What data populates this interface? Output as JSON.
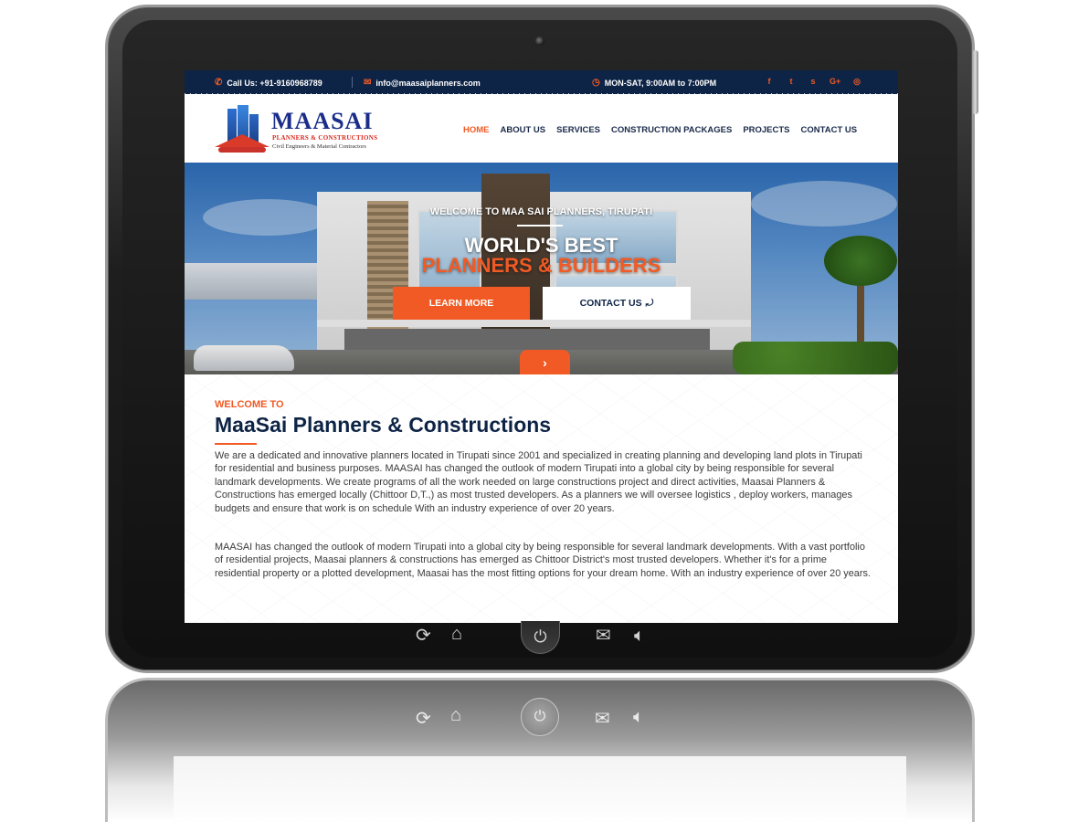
{
  "topbar": {
    "phone": "Call Us: +91-9160968789",
    "email": "info@maasaiplanners.com",
    "hours": "MON-SAT, 9:00AM to 7:00PM",
    "social": [
      "facebook-icon",
      "twitter-icon",
      "skype-icon",
      "google-plus-icon",
      "instagram-icon"
    ],
    "social_glyphs": [
      "f",
      "t",
      "s",
      "G+",
      "◎"
    ]
  },
  "logo": {
    "title": "MAASAI",
    "subtitle": "PLANNERS & CONSTRUCTIONS",
    "tagline": "Civil Engineers & Material Contractors"
  },
  "nav": {
    "items": [
      "HOME",
      "ABOUT US",
      "SERVICES",
      "CONSTRUCTION PACKAGES",
      "PROJECTS",
      "CONTACT US"
    ],
    "active": "HOME"
  },
  "hero": {
    "welcome": "WELCOME TO MAA SAI PLANNERS, TIRUPATI",
    "title_line1": "WORLD'S BEST",
    "title_line2": "PLANNERS & BUILDERS",
    "learn_more": "LEARN MORE",
    "contact_us": "CONTACT US",
    "next_arrow": "›"
  },
  "about": {
    "kicker": "WELCOME TO",
    "title": "MaaSai Planners & Constructions",
    "paragraph1": "We are a dedicated and innovative planners located in Tirupati since 2001 and specialized in creating planning and developing land plots in Tirupati for residential and business purposes. MAASAI has changed the outlook of modern Tirupati into a global city by being responsible for several landmark developments. We create programs of all the work needed on large constructions project and direct activities, Maasai Planners & Constructions has emerged locally (Chittoor D,T.,) as  most trusted developers. As a planners we will oversee logistics , deploy workers, manages budgets and ensure that work is on schedule With an industry experience of over 20 years.",
    "paragraph2": "MAASAI has changed the outlook of modern Tirupati into a global city by being responsible for several landmark developments. With a vast portfolio of residential projects, Maasai planners & constructions has emerged as Chittoor District's most trusted developers. Whether it's for a prime residential property or a plotted development, Maasai has the most fitting options for your dream home. With an industry experience of over 20 years."
  },
  "colors": {
    "accent": "#f15a24",
    "navy": "#0e2446"
  }
}
